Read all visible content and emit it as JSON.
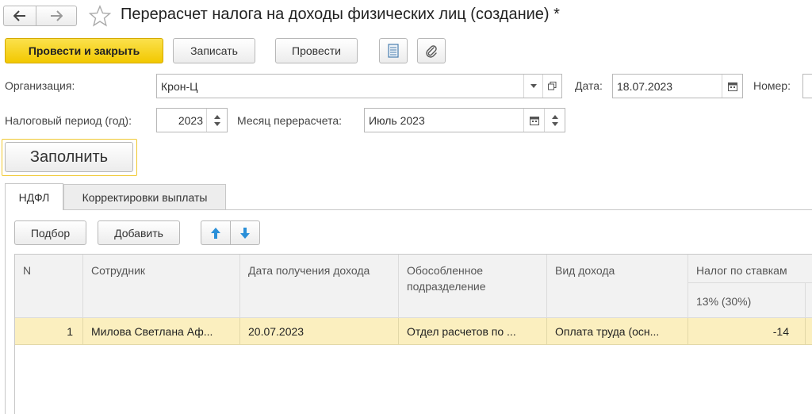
{
  "window": {
    "title": "Перерасчет налога на доходы физических лиц (создание) *"
  },
  "toolbar": {
    "post_close_label": "Провести и закрыть",
    "save_label": "Записать",
    "post_label": "Провести"
  },
  "form": {
    "org_label": "Организация:",
    "org_value": "Крон-Ц",
    "date_label": "Дата:",
    "date_value": "18.07.2023",
    "number_label": "Номер:",
    "period_label": "Налоговый период (год):",
    "period_value": "2023",
    "month_label": "Месяц перерасчета:",
    "month_value": "Июль 2023",
    "fill_label": "Заполнить"
  },
  "tabs": [
    {
      "label": "НДФЛ",
      "active": true
    },
    {
      "label": "Корректировки выплаты",
      "active": false
    }
  ],
  "table_toolbar": {
    "select_label": "Подбор",
    "add_label": "Добавить"
  },
  "table": {
    "columns": {
      "n": "N",
      "employee": "Сотрудник",
      "income_date": "Дата получения дохода",
      "subdivision": "Обособленное подразделение",
      "income_type": "Вид дохода",
      "tax_by_rates": "Налог по ставкам",
      "rate_13": "13% (30%)"
    },
    "rows": [
      {
        "n": "1",
        "employee": "Милова Светлана Аф...",
        "income_date": "20.07.2023",
        "subdivision": "Отдел расчетов по ...",
        "income_type": "Оплата труда (осн...",
        "rate_13": "-14"
      }
    ]
  },
  "colors": {
    "primary": "#f5cc0a",
    "selected_row": "#fbefbf",
    "arrow_blue": "#2a8fd8"
  }
}
